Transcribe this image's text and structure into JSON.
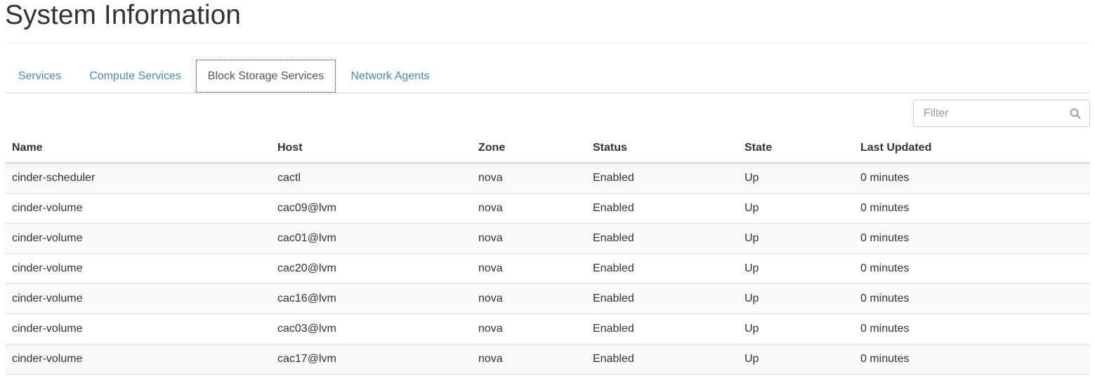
{
  "page": {
    "title": "System Information"
  },
  "tabs": [
    {
      "label": "Services",
      "active": false
    },
    {
      "label": "Compute Services",
      "active": false
    },
    {
      "label": "Block Storage Services",
      "active": true
    },
    {
      "label": "Network Agents",
      "active": false
    }
  ],
  "filter": {
    "placeholder": "Filter",
    "value": "",
    "icon": "search-icon"
  },
  "table": {
    "columns": [
      "Name",
      "Host",
      "Zone",
      "Status",
      "State",
      "Last Updated"
    ],
    "rows": [
      [
        "cinder-scheduler",
        "cactl",
        "nova",
        "Enabled",
        "Up",
        "0 minutes"
      ],
      [
        "cinder-volume",
        "cac09@lvm",
        "nova",
        "Enabled",
        "Up",
        "0 minutes"
      ],
      [
        "cinder-volume",
        "cac01@lvm",
        "nova",
        "Enabled",
        "Up",
        "0 minutes"
      ],
      [
        "cinder-volume",
        "cac20@lvm",
        "nova",
        "Enabled",
        "Up",
        "0 minutes"
      ],
      [
        "cinder-volume",
        "cac16@lvm",
        "nova",
        "Enabled",
        "Up",
        "0 minutes"
      ],
      [
        "cinder-volume",
        "cac03@lvm",
        "nova",
        "Enabled",
        "Up",
        "0 minutes"
      ],
      [
        "cinder-volume",
        "cac17@lvm",
        "nova",
        "Enabled",
        "Up",
        "0 minutes"
      ]
    ]
  },
  "colors": {
    "link": "#428bca",
    "text": "#333333",
    "border": "#dddddd",
    "stripe": "#f9f9f9"
  }
}
